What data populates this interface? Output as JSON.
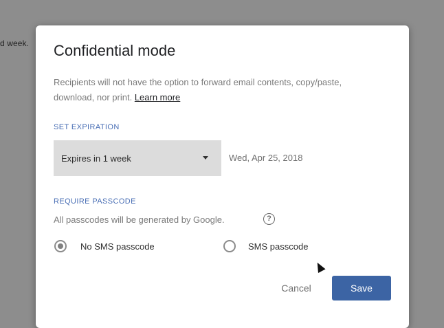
{
  "background": {
    "text": "d week."
  },
  "dialog": {
    "title": "Confidential mode",
    "description": "Recipients will not have the option to forward email contents, copy/paste, download, nor print.",
    "learn_more": "Learn more",
    "expiration": {
      "label": "SET EXPIRATION",
      "selected": "Expires in 1 week",
      "date": "Wed, Apr 25, 2018"
    },
    "passcode": {
      "label": "REQUIRE PASSCODE",
      "description": "All passcodes will be generated by Google.",
      "help": "?",
      "options": [
        {
          "label": "No SMS passcode",
          "selected": true
        },
        {
          "label": "SMS passcode",
          "selected": false
        }
      ]
    },
    "buttons": {
      "cancel": "Cancel",
      "save": "Save"
    },
    "colors": {
      "save": "#3c64a4",
      "section_label": "#4a6fb5",
      "select_bg": "#dcdcdc"
    }
  }
}
